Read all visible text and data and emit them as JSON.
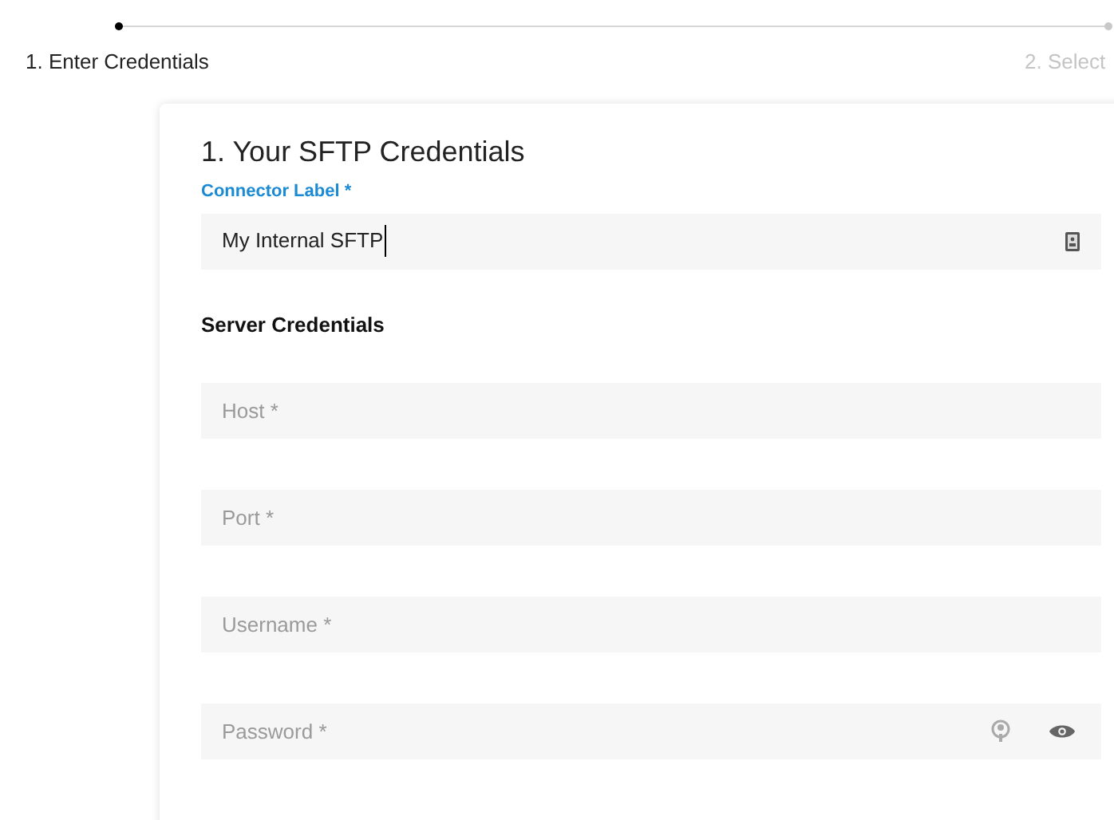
{
  "steps": [
    {
      "label": "1. Enter Credentials",
      "selected": true
    },
    {
      "label": "2. Select",
      "selected": false
    }
  ],
  "form": {
    "title": "1. Your SFTP Credentials",
    "connector_label": {
      "label": "Connector Label *",
      "value": "My Internal SFTP"
    },
    "section_title": "Server Credentials",
    "fields": [
      {
        "placeholder": "Host *",
        "kind": "text"
      },
      {
        "placeholder": "Port *",
        "kind": "text"
      },
      {
        "placeholder": "Username *",
        "kind": "text"
      },
      {
        "placeholder": "Password *",
        "kind": "password"
      }
    ]
  }
}
